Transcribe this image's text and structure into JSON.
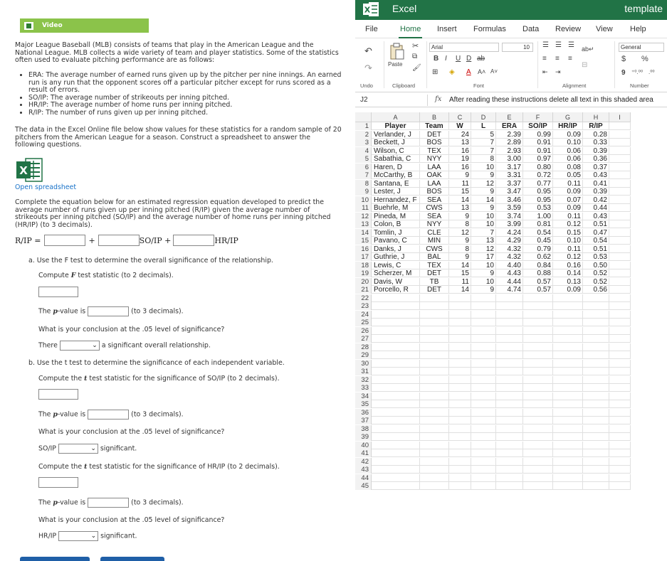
{
  "question": {
    "video_label": "Video",
    "intro": "Major League Baseball (MLB) consists of teams that play in the American League and the National League. MLB collects a wide variety of team and player statistics. Some of the statistics often used to evaluate pitching performance are as follows:",
    "bullets": [
      "ERA: The average number of earned runs given up by the pitcher per nine innings. An earned run is any run that the opponent scores off a particular pitcher except for runs scored as a result of errors.",
      "SO/IP: The average number of strikeouts per inning pitched.",
      "HR/IP: The average number of home runs per inning pitched.",
      "R/IP: The number of runs given up per inning pitched."
    ],
    "data_text": "The data in the Excel Online file below show values for these statistics for a random sample of 20 pitchers from the American League for a season. Construct a spreadsheet to answer the following questions.",
    "open_spreadsheet": "Open spreadsheet",
    "equation_intro": "Complete the equation below for an estimated regression equation developed to predict the average number of runs given up per inning pitched (R/IP) given the average number of strikeouts per inning pitched (SO/IP) and the average number of home runs per inning pitched (HR/IP) (to 3 decimals).",
    "eq_lhs": "R/IP =",
    "eq_plus": "+",
    "eq_so": "SO/IP +",
    "eq_hr": "HR/IP",
    "part_a": "a. Use the F test to determine the overall significance of the relationship.",
    "a_compute_pre": "Compute ",
    "a_F": "F",
    "a_compute_post": " test statistic (to 2 decimals).",
    "pvalue_pre": "The ",
    "pvalue_p": "p",
    "pvalue_mid": "-value is",
    "pvalue_post": "(to 3 decimals).",
    "conclusion_q": "What is your conclusion at the .05 level of significance?",
    "there_label": "There",
    "there_post": "a significant overall relationship.",
    "part_b": "b. Use the t test to determine the significance of each independent variable.",
    "b_compute_so_pre": "Compute the ",
    "b_t": "t",
    "b_compute_so_post": " test statistic for the significance of SO/IP (to 2 decimals).",
    "so_label": "SO/IP",
    "significant": "significant.",
    "b_compute_hr_post": " test statistic for the significance of HR/IP (to 2 decimals).",
    "hr_label": "HR/IP",
    "select_arrow": "⌄"
  },
  "excel": {
    "app_name": "Excel",
    "doc_name": "template",
    "tabs": [
      "File",
      "Home",
      "Insert",
      "Formulas",
      "Data",
      "Review",
      "View",
      "Help"
    ],
    "active_tab": "Home",
    "ribbon": {
      "undo": "Undo",
      "clipboard": "Clipboard",
      "paste": "Paste",
      "font_name": "Arial",
      "font_size": "10",
      "font": "Font",
      "alignment": "Alignment",
      "number_format": "General",
      "number": "Number",
      "bold": "B",
      "italic": "I",
      "underline": "U",
      "strike": "D",
      "currency": "$",
      "percent": "%"
    },
    "name_box": "J2",
    "fx": "fx",
    "formula_text": "After reading these instructions delete all text in this shaded area",
    "columns": [
      "A",
      "B",
      "C",
      "D",
      "E",
      "F",
      "G",
      "H",
      "I"
    ],
    "headers": [
      "Player",
      "Team",
      "W",
      "L",
      "ERA",
      "SO/IP",
      "HR/IP",
      "R/IP"
    ],
    "rows": [
      [
        "Verlander, J",
        "DET",
        "24",
        "5",
        "2.39",
        "0.99",
        "0.09",
        "0.28"
      ],
      [
        "Beckett, J",
        "BOS",
        "13",
        "7",
        "2.89",
        "0.91",
        "0.10",
        "0.33"
      ],
      [
        "Wilson, C",
        "TEX",
        "16",
        "7",
        "2.93",
        "0.91",
        "0.06",
        "0.39"
      ],
      [
        "Sabathia, C",
        "NYY",
        "19",
        "8",
        "3.00",
        "0.97",
        "0.06",
        "0.36"
      ],
      [
        "Haren, D",
        "LAA",
        "16",
        "10",
        "3.17",
        "0.80",
        "0.08",
        "0.37"
      ],
      [
        "McCarthy, B",
        "OAK",
        "9",
        "9",
        "3.31",
        "0.72",
        "0.05",
        "0.43"
      ],
      [
        "Santana, E",
        "LAA",
        "11",
        "12",
        "3.37",
        "0.77",
        "0.11",
        "0.41"
      ],
      [
        "Lester, J",
        "BOS",
        "15",
        "9",
        "3.47",
        "0.95",
        "0.09",
        "0.39"
      ],
      [
        "Hernandez, F",
        "SEA",
        "14",
        "14",
        "3.46",
        "0.95",
        "0.07",
        "0.42"
      ],
      [
        "Buehrle, M",
        "CWS",
        "13",
        "9",
        "3.59",
        "0.53",
        "0.09",
        "0.44"
      ],
      [
        "Pineda, M",
        "SEA",
        "9",
        "10",
        "3.74",
        "1.00",
        "0.11",
        "0.43"
      ],
      [
        "Colon, B",
        "NYY",
        "8",
        "10",
        "3.99",
        "0.81",
        "0.12",
        "0.51"
      ],
      [
        "Tomlin, J",
        "CLE",
        "12",
        "7",
        "4.24",
        "0.54",
        "0.15",
        "0.47"
      ],
      [
        "Pavano, C",
        "MIN",
        "9",
        "13",
        "4.29",
        "0.45",
        "0.10",
        "0.54"
      ],
      [
        "Danks, J",
        "CWS",
        "8",
        "12",
        "4.32",
        "0.79",
        "0.11",
        "0.51"
      ],
      [
        "Guthrie, J",
        "BAL",
        "9",
        "17",
        "4.32",
        "0.62",
        "0.12",
        "0.53"
      ],
      [
        "Lewis, C",
        "TEX",
        "14",
        "10",
        "4.40",
        "0.84",
        "0.16",
        "0.50"
      ],
      [
        "Scherzer, M",
        "DET",
        "15",
        "9",
        "4.43",
        "0.88",
        "0.14",
        "0.52"
      ],
      [
        "Davis, W",
        "TB",
        "11",
        "10",
        "4.44",
        "0.57",
        "0.13",
        "0.52"
      ],
      [
        "Porcello, R",
        "DET",
        "14",
        "9",
        "4.74",
        "0.57",
        "0.09",
        "0.56"
      ]
    ],
    "total_rows": 45
  },
  "colors": {
    "excel_green": "#217346",
    "video_green": "#8bc34a",
    "link_blue": "#1a73c9"
  }
}
